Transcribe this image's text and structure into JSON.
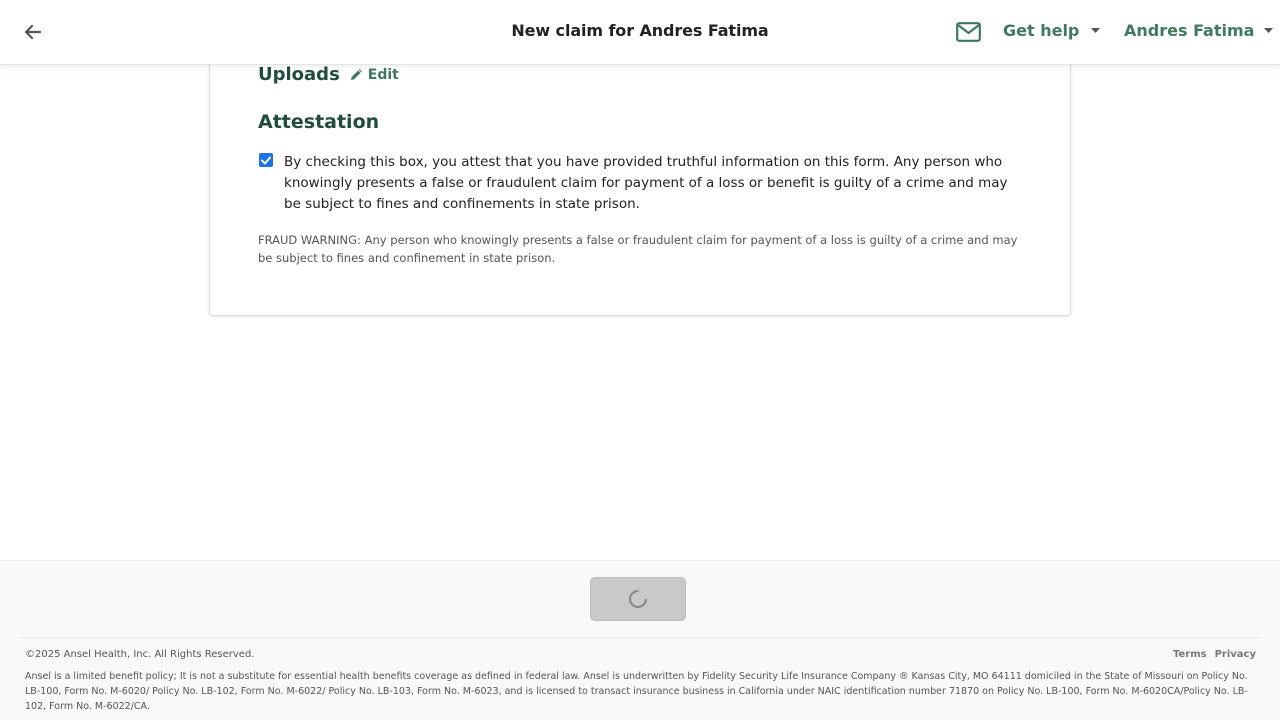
{
  "header": {
    "title": "New claim for Andres Fatima",
    "help_label": "Get help",
    "user_name": "Andres Fatima",
    "accent_color": "#3f7a5c"
  },
  "review": {
    "uploads_title": "Uploads",
    "edit_label": "Edit",
    "attestation_title": "Attestation",
    "attestation_checked": true,
    "attestation_text": "By checking this box, you attest that you have provided truthful information on this form. Any person who knowingly presents a false or fraudulent claim for payment of a loss or benefit is guilty of a crime and may be subject to fines and confinements in state prison.",
    "fraud_warning": "FRAUD WARNING: Any person who knowingly presents a false or fraudulent claim for payment of a loss is guilty of a crime and may be subject to fines and confinement in state prison."
  },
  "footer": {
    "submit_state": "loading",
    "copyright": "©2025 Ansel Health, Inc. All Rights Reserved.",
    "links": [
      "Terms",
      "Privacy"
    ],
    "disclaimer": "Ansel is a limited benefit policy; It is not a substitute for essential health benefits coverage as defined in federal law. Ansel is underwritten by Fidelity Security Life Insurance Company ® Kansas City, MO 64111 domiciled in the State of Missouri on Policy No. LB-100, Form No. M-6020/ Policy No. LB-102, Form No. M-6022/ Policy No. LB-103, Form No. M-6023, and is licensed to transact insurance business in California under NAIC identification number 71870 on Policy No. LB-100, Form No. M-6020CA/Policy No. LB-102, Form No. M-6022/CA."
  }
}
